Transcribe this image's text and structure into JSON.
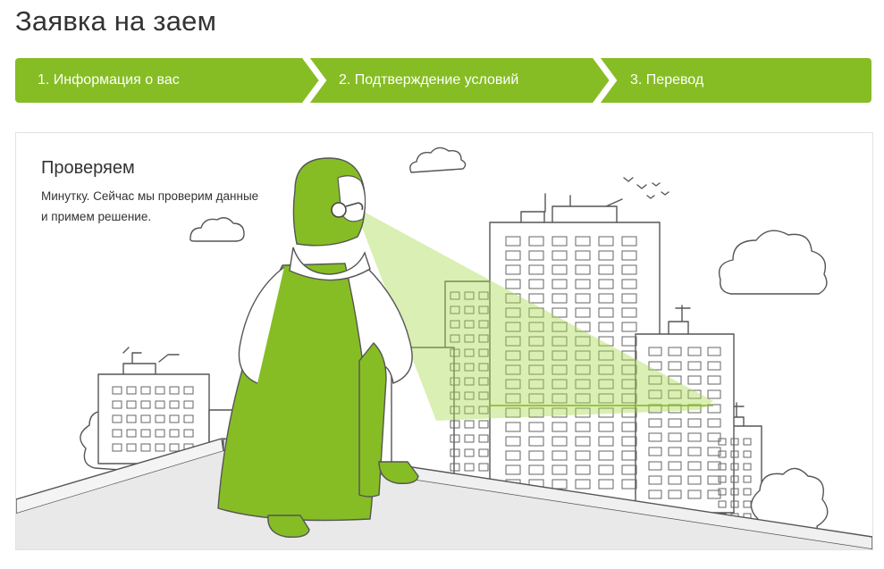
{
  "page": {
    "title": "Заявка на заем"
  },
  "steps": [
    {
      "label": "1. Информация о вас"
    },
    {
      "label": "2. Подтверждение условий"
    },
    {
      "label": "3. Перевод"
    }
  ],
  "status": {
    "title": "Проверяем",
    "text": "Минутку. Сейчас мы проверим данные и примем решение."
  },
  "illustration": {
    "name": "superhero-looking-at-city"
  },
  "colors": {
    "accent": "#86bd25",
    "accent_light": "#a8d94a",
    "line": "#555555"
  }
}
